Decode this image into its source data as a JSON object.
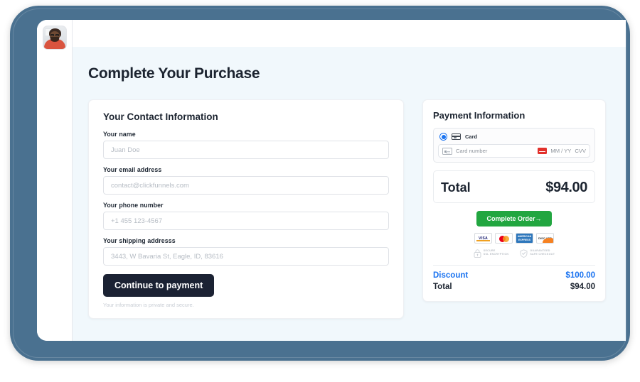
{
  "window": {
    "avatar_alt": "user-avatar-photo"
  },
  "page": {
    "title": "Complete Your Purchase"
  },
  "contact": {
    "title": "Your Contact Information",
    "fields": [
      {
        "label": "Your name",
        "placeholder": "Juan Doe",
        "value": ""
      },
      {
        "label": "Your email address",
        "placeholder": "contact@clickfunnels.com",
        "value": ""
      },
      {
        "label": "Your phone number",
        "placeholder": "+1 455 123-4567",
        "value": ""
      },
      {
        "label": "Your shipping addresss",
        "placeholder": "3443, W Bavaria St, Eagle, ID, 83616",
        "value": ""
      }
    ],
    "continue_label": "Continue to payment",
    "privacy_note": "Your information is private and secure."
  },
  "payment": {
    "title": "Payment Information",
    "method_label": "Card",
    "method_selected": true,
    "card_number_placeholder": "Card number",
    "expiry_placeholder": "MM / YY",
    "cvv_placeholder": "CVV",
    "total_label": "Total",
    "total_value": "$94.00",
    "complete_order_label": "Complete Order",
    "complete_order_arrow": "→",
    "card_logos": [
      {
        "name": "visa",
        "text": "VISA"
      },
      {
        "name": "mastercard",
        "text": ""
      },
      {
        "name": "amex",
        "text": "AMERICAN EXPRESS"
      },
      {
        "name": "discover",
        "text": "DISC VER"
      }
    ],
    "trust_badges": [
      {
        "icon": "lock-icon",
        "line1": "SECURE",
        "line2": "SSL ENCRYPTION"
      },
      {
        "icon": "shield-check-icon",
        "line1": "GUARANTEED",
        "line2": "SAFE CHECKOUT"
      }
    ],
    "summary": [
      {
        "label": "Discount",
        "value": "$100.00",
        "style": "discount"
      },
      {
        "label": "Total",
        "value": "$94.00",
        "style": "total"
      }
    ]
  },
  "colors": {
    "frame": "#4a7190",
    "page_bg": "#f1f8fc",
    "accent_blue": "#1a73f0",
    "accent_green": "#22a640",
    "dark_button": "#1b2233"
  }
}
